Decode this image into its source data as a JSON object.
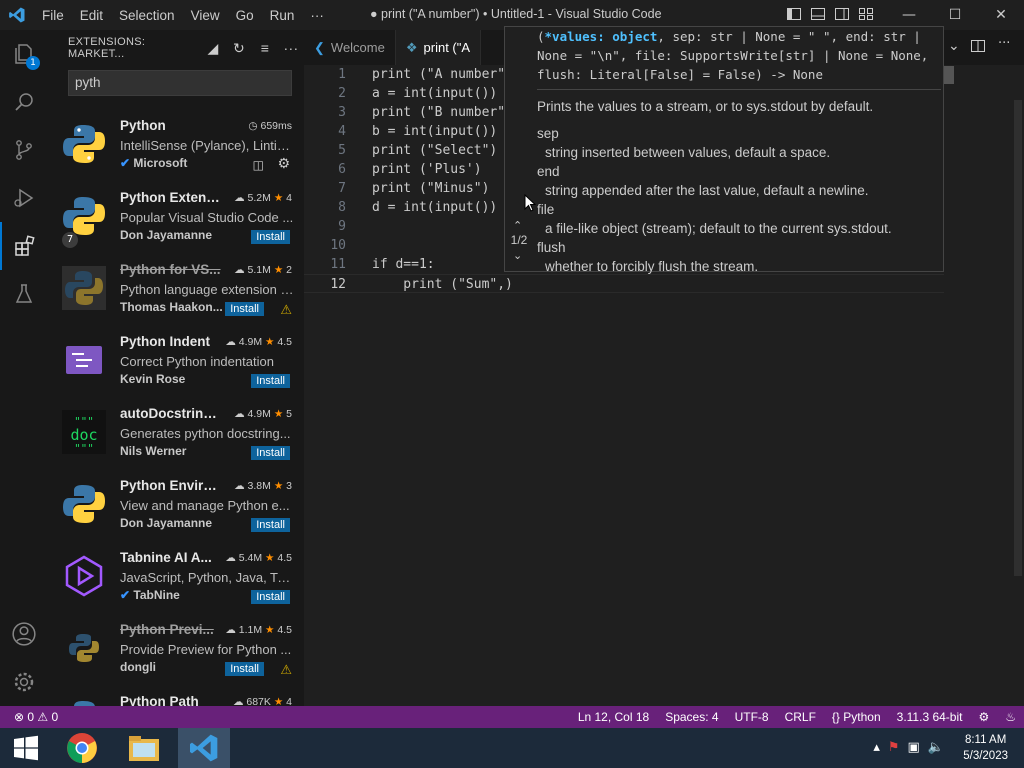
{
  "titlebar": {
    "menu": [
      "File",
      "Edit",
      "Selection",
      "View",
      "Go",
      "Run",
      "···"
    ],
    "window_title": "● print (\"A number\") • Untitled-1 - Visual Studio Code"
  },
  "activity": {
    "explorer_badge": "1",
    "extensions_badge": "7"
  },
  "sidebar": {
    "title": "EXTENSIONS: MARKET...",
    "search_value": "pyth",
    "extensions": [
      {
        "name": "Python",
        "stat": "659ms",
        "desc": "IntelliSense (Pylance), Lintin...",
        "publisher": "Microsoft",
        "install": ""
      },
      {
        "name": "Python Extens...",
        "stat": "5.2M",
        "rating": "4",
        "desc": "Popular Visual Studio Code ...",
        "publisher": "Don Jayamanne",
        "install": "Install"
      },
      {
        "name": "Python for VS...",
        "stat": "5.1M",
        "rating": "2",
        "desc": "Python language extension f...",
        "publisher": "Thomas Haakon...",
        "install": "Install"
      },
      {
        "name": "Python Indent",
        "stat": "4.9M",
        "rating": "4.5",
        "desc": "Correct Python indentation",
        "publisher": "Kevin Rose",
        "install": "Install"
      },
      {
        "name": "autoDocstring...",
        "stat": "4.9M",
        "rating": "5",
        "desc": "Generates python docstring...",
        "publisher": "Nils Werner",
        "install": "Install"
      },
      {
        "name": "Python Enviro...",
        "stat": "3.8M",
        "rating": "3",
        "desc": "View and manage Python e...",
        "publisher": "Don Jayamanne",
        "install": "Install"
      },
      {
        "name": "Tabnine AI A...",
        "stat": "5.4M",
        "rating": "4.5",
        "desc": "JavaScript, Python, Java, Typ...",
        "publisher": "TabNine",
        "install": "Install"
      },
      {
        "name": "Python Previ...",
        "stat": "1.1M",
        "rating": "4.5",
        "desc": "Provide Preview for Python ...",
        "publisher": "dongli",
        "install": "Install"
      },
      {
        "name": "Python Path",
        "stat": "687K",
        "rating": "4",
        "desc": "",
        "publisher": "",
        "install": ""
      }
    ]
  },
  "editor": {
    "tabs": [
      {
        "label": "Welcome"
      },
      {
        "label": "print (\"A"
      }
    ],
    "lines": [
      {
        "num": "1",
        "text": "print (\"A number\""
      },
      {
        "num": "2",
        "text": "a = int(input())"
      },
      {
        "num": "3",
        "text": "print (\"B number\""
      },
      {
        "num": "4",
        "text": "b = int(input())"
      },
      {
        "num": "5",
        "text": "print (\"Select\")"
      },
      {
        "num": "6",
        "text": "print ('Plus')"
      },
      {
        "num": "7",
        "text": "print (\"Minus\")"
      },
      {
        "num": "8",
        "text": "d = int(input())"
      },
      {
        "num": "9",
        "text": ""
      },
      {
        "num": "10",
        "text": ""
      },
      {
        "num": "11",
        "text": "if d==1:"
      },
      {
        "num": "12",
        "text": "    print (\"Sum\",)"
      }
    ],
    "hover": {
      "sig_highlight": "*values: object",
      "sig_rest": ", sep: str | None = \" \", end: str | None = \"\\n\", file: SupportsWrite[str] | None = None, flush: Literal[False] = False) -> None",
      "summary": "Prints the values to a stream, or to sys.stdout by default.",
      "params": [
        {
          "name": "sep",
          "desc": "string inserted between values, default a space."
        },
        {
          "name": "end",
          "desc": "string appended after the last value, default a newline."
        },
        {
          "name": "file",
          "desc": "a file-like object (stream); default to the current sys.stdout."
        },
        {
          "name": "flush",
          "desc": "whether to forcibly flush the stream."
        }
      ],
      "counter": "1/2"
    }
  },
  "statusbar": {
    "problems": "⊗ 0 ⚠ 0",
    "position": "Ln 12, Col 18",
    "spaces": "Spaces: 4",
    "encoding": "UTF-8",
    "eol": "CRLF",
    "language": "Python",
    "interpreter": "3.11.3 64-bit"
  },
  "taskbar": {
    "time": "8:11 AM",
    "date": "5/3/2023"
  },
  "colors": {
    "statusbar": "#68217a",
    "accent": "#0078d4",
    "install": "#0e639c"
  }
}
